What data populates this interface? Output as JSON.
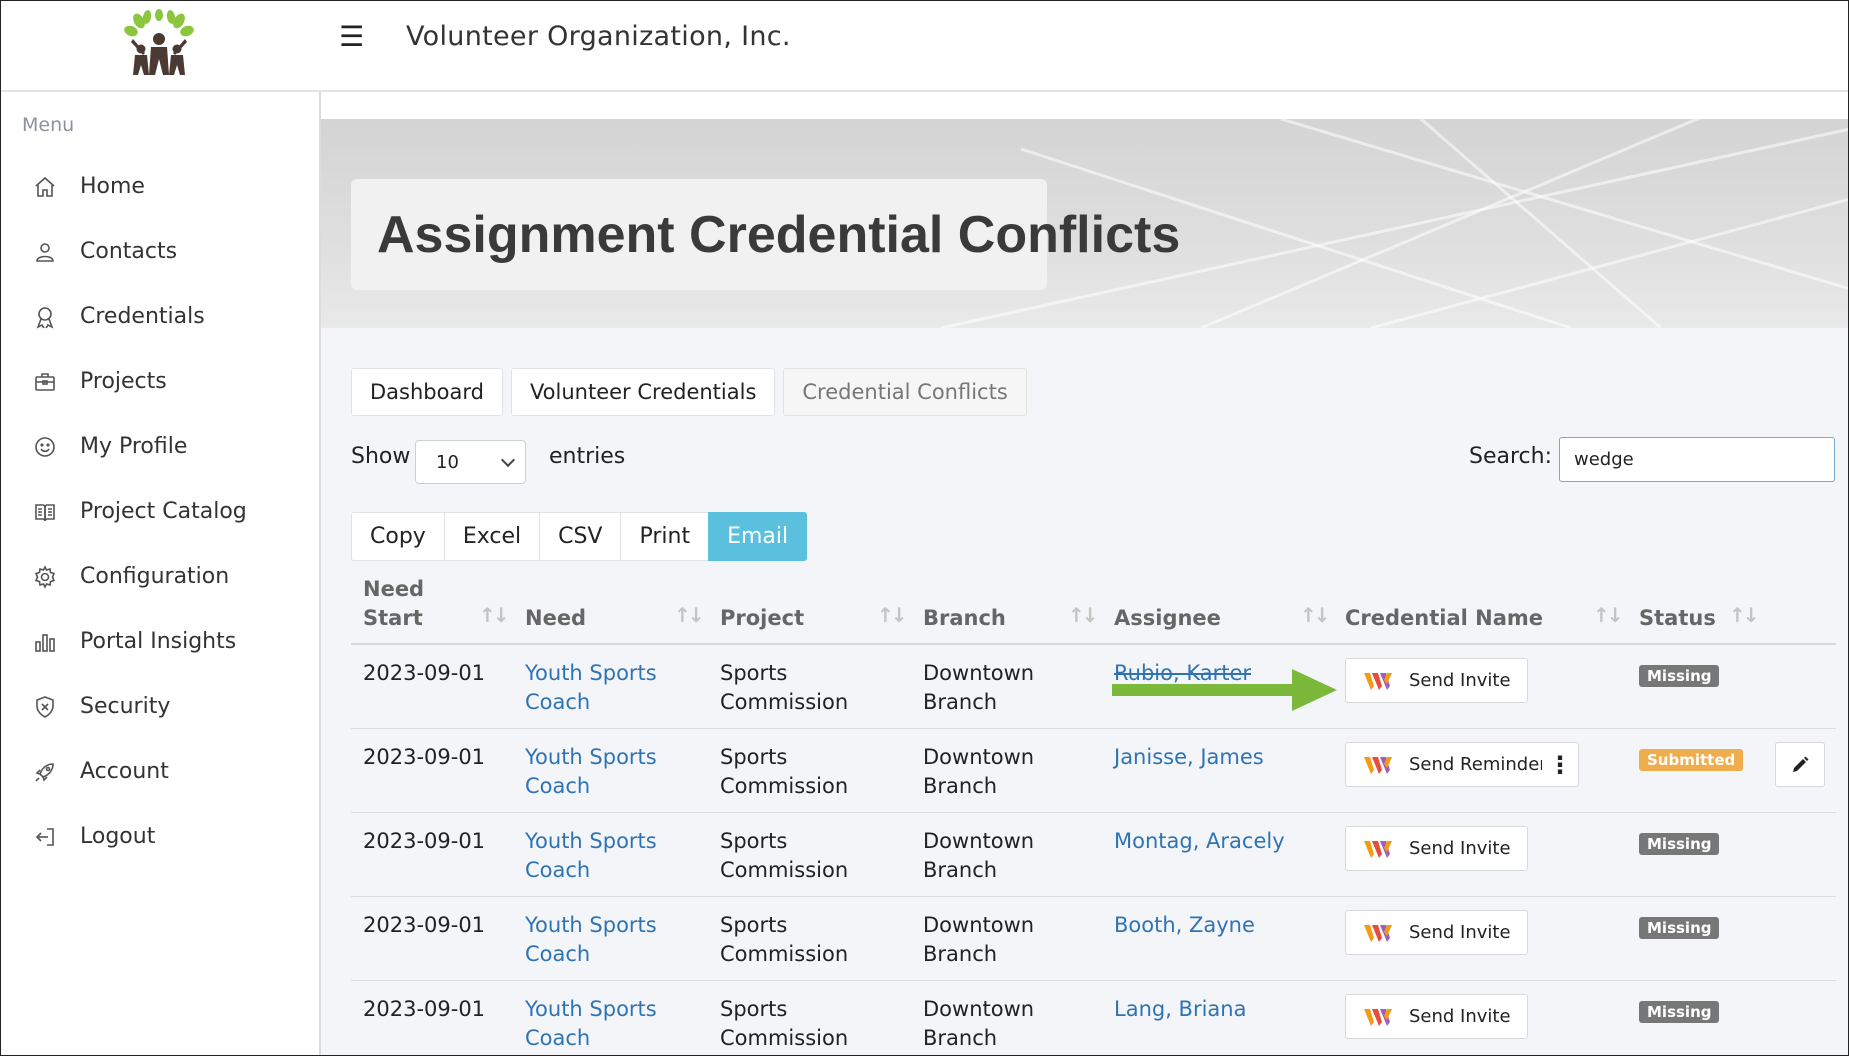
{
  "app": {
    "title": "Volunteer Organization, Inc."
  },
  "sidebar": {
    "heading": "Menu",
    "items": [
      {
        "label": "Home",
        "icon": "home-icon"
      },
      {
        "label": "Contacts",
        "icon": "contacts-icon"
      },
      {
        "label": "Credentials",
        "icon": "credentials-icon"
      },
      {
        "label": "Projects",
        "icon": "briefcase-icon"
      },
      {
        "label": "My Profile",
        "icon": "smiley-icon"
      },
      {
        "label": "Project Catalog",
        "icon": "book-icon"
      },
      {
        "label": "Configuration",
        "icon": "gear-icon"
      },
      {
        "label": "Portal Insights",
        "icon": "bar-chart-icon"
      },
      {
        "label": "Security",
        "icon": "shield-icon"
      },
      {
        "label": "Account",
        "icon": "rocket-icon"
      },
      {
        "label": "Logout",
        "icon": "logout-icon"
      }
    ]
  },
  "page": {
    "title": "Assignment Credential Conflicts"
  },
  "tabs": [
    {
      "label": "Dashboard",
      "active": false
    },
    {
      "label": "Volunteer Credentials",
      "active": false
    },
    {
      "label": "Credential Conflicts",
      "active": true
    }
  ],
  "controls": {
    "show_label": "Show",
    "entries_value": "10",
    "entries_label": "entries",
    "search_label": "Search:",
    "search_value": "wedge"
  },
  "export_buttons": [
    "Copy",
    "Excel",
    "CSV",
    "Print",
    "Email"
  ],
  "table": {
    "columns": [
      "Need Start",
      "Need",
      "Project",
      "Branch",
      "Assignee",
      "Credential Name",
      "Status"
    ],
    "rows": [
      {
        "need_start": "2023-09-01",
        "need": "Youth Sports Coach",
        "project": "Sports Commission",
        "branch": "Downtown Branch",
        "assignee": "Rubio, Karter",
        "action": "Send Invite",
        "status": "Missing"
      },
      {
        "need_start": "2023-09-01",
        "need": "Youth Sports Coach",
        "project": "Sports Commission",
        "branch": "Downtown Branch",
        "assignee": "Janisse, James",
        "action": "Send Reminder",
        "status": "Submitted"
      },
      {
        "need_start": "2023-09-01",
        "need": "Youth Sports Coach",
        "project": "Sports Commission",
        "branch": "Downtown Branch",
        "assignee": "Montag, Aracely",
        "action": "Send Invite",
        "status": "Missing"
      },
      {
        "need_start": "2023-09-01",
        "need": "Youth Sports Coach",
        "project": "Sports Commission",
        "branch": "Downtown Branch",
        "assignee": "Booth, Zayne",
        "action": "Send Invite",
        "status": "Missing"
      },
      {
        "need_start": "2023-09-01",
        "need": "Youth Sports Coach",
        "project": "Sports Commission",
        "branch": "Downtown Branch",
        "assignee": "Lang, Briana",
        "action": "Send Invite",
        "status": "Missing"
      }
    ]
  },
  "colors": {
    "link": "#2e74b5",
    "email_button": "#5bc0de",
    "missing_badge": "#777777",
    "submitted_badge": "#f0ad4e",
    "annotation_arrow": "#7cb83a"
  }
}
